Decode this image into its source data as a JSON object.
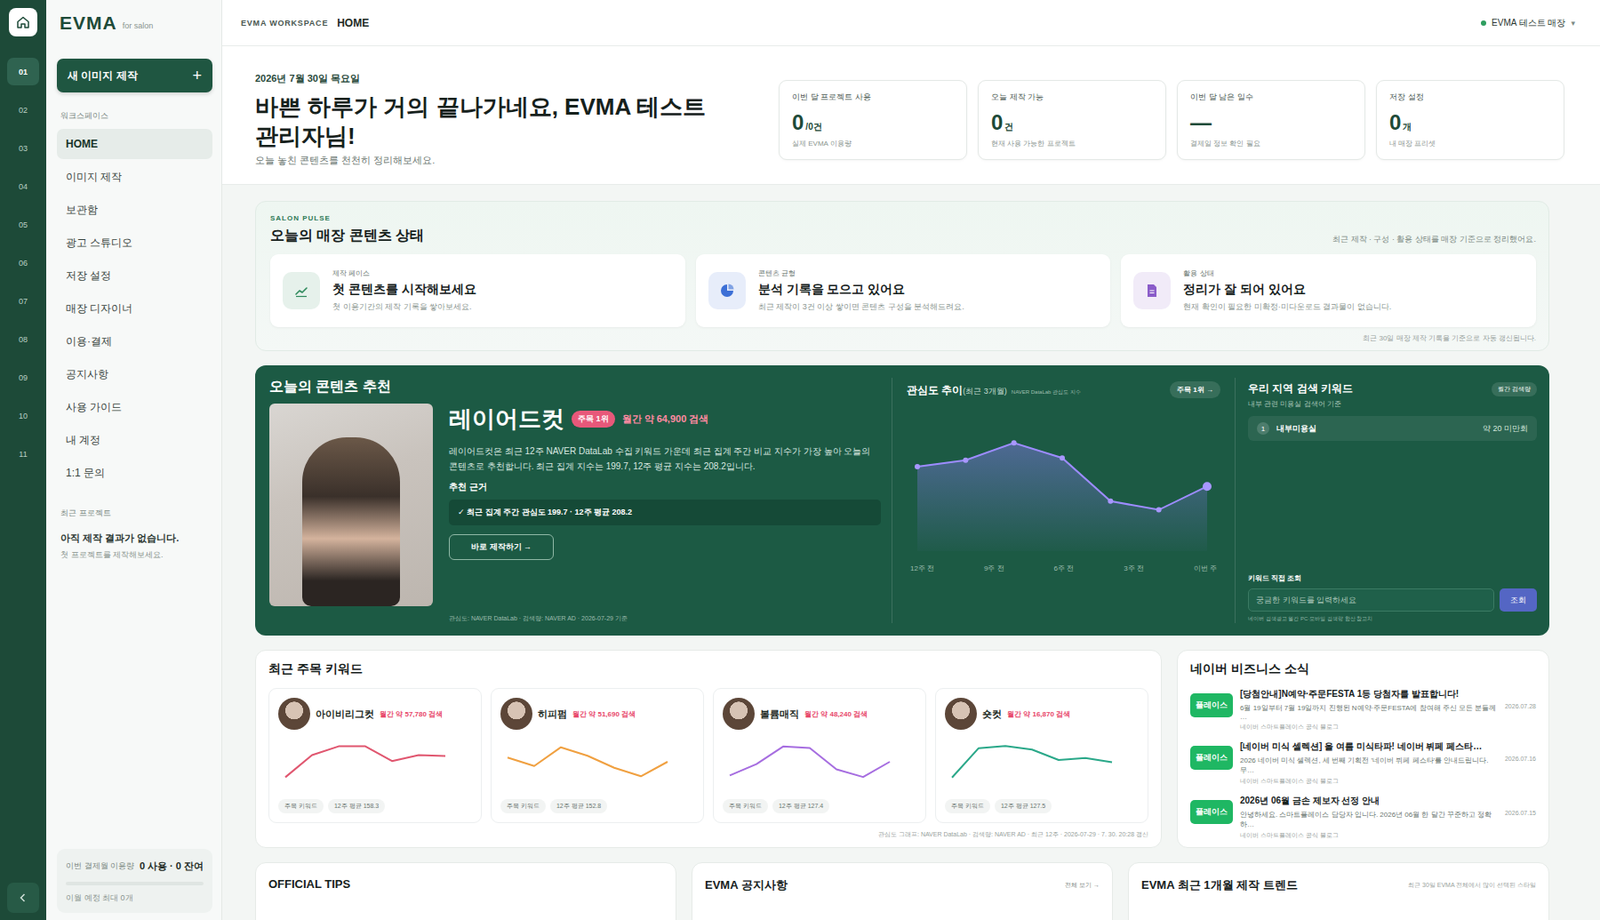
{
  "rail": {
    "items": [
      {
        "label": "01",
        "selected": true
      },
      {
        "label": "02",
        "selected": false
      },
      {
        "label": "03",
        "selected": false
      },
      {
        "label": "04",
        "selected": false
      },
      {
        "label": "05",
        "selected": false
      },
      {
        "label": "06",
        "selected": false
      },
      {
        "label": "07",
        "selected": false
      },
      {
        "label": "08",
        "selected": false
      },
      {
        "label": "09",
        "selected": false
      },
      {
        "label": "10",
        "selected": false
      },
      {
        "label": "11",
        "selected": false
      }
    ]
  },
  "brand": {
    "name": "EVMA",
    "tagline": "for salon"
  },
  "sidebar": {
    "new_button": "새 이미지 제작",
    "new_icon": "+",
    "section": "워크스페이스",
    "items": [
      {
        "label": "HOME",
        "selected": true
      },
      {
        "label": "이미지 제작",
        "selected": false
      },
      {
        "label": "보관함",
        "selected": false
      },
      {
        "label": "광고 스튜디오",
        "selected": false
      },
      {
        "label": "저장 설정",
        "selected": false
      },
      {
        "label": "매장 디자이너",
        "selected": false
      },
      {
        "label": "이용·결제",
        "selected": false
      },
      {
        "label": "공지사항",
        "selected": false
      },
      {
        "label": "사용 가이드",
        "selected": false
      },
      {
        "label": "내 계정",
        "selected": false
      },
      {
        "label": "1:1 문의",
        "selected": false
      }
    ],
    "recent_title": "최근 프로젝트",
    "recent_empty": "아직 제작 결과가 없습니다.",
    "recent_hint": "첫 프로젝트를 제작해보세요.",
    "usage": {
      "label": "이번 결제월 이용량",
      "value": "0 사용 · 0 잔여",
      "level": 0,
      "note": "이월 예정 최대 0개"
    }
  },
  "topbar": {
    "workspace": "EVMA WORKSPACE",
    "page": "HOME",
    "store": "EVMA 테스트 매장",
    "store_caret": "▾"
  },
  "header": {
    "date": "2026년 7월 30일 목요일",
    "title": "바쁜 하루가 거의 끝나가네요, EVMA 테스트 관리자님!",
    "subtitle": "오늘 놓친 콘텐츠를 천천히 정리해보세요.",
    "stats": [
      {
        "label": "이번 달 프로젝트 사용",
        "value": "0",
        "unit": "/0건",
        "note": "실제 EVMA 이용량"
      },
      {
        "label": "오늘 제작 가능",
        "value": "0",
        "unit": "건",
        "note": "현재 사용 가능한 프로젝트"
      },
      {
        "label": "이번 달 남은 일수",
        "value": "—",
        "unit": "",
        "note": "결제일 정보 확인 필요"
      },
      {
        "label": "저장 설정",
        "value": "0",
        "unit": "개",
        "note": "내 매장 프리셋"
      }
    ]
  },
  "pulse": {
    "eyebrow": "SALON PULSE",
    "title": "오늘의 매장 콘텐츠 상태",
    "note": "최근 제작 · 구성 · 활용 상태를 매장 기준으로 정리했어요.",
    "cards": [
      {
        "label": "제작 페이스",
        "title": "첫 콘텐츠를 시작해보세요",
        "desc": "첫 이용기간의 제작 기록을 쌓아보세요.",
        "color": "#2f8a5c"
      },
      {
        "label": "콘텐츠 균형",
        "title": "분석 기록을 모으고 있어요",
        "desc": "최근 제작이 3건 이상 쌓이면 콘텐츠 구성을 분석해드려요.",
        "color": "#3c6fd6"
      },
      {
        "label": "활용 상태",
        "title": "정리가 잘 되어 있어요",
        "desc": "현재 확인이 필요한 미확정·미다운로드 결과물이 없습니다.",
        "color": "#8a5cc9"
      }
    ],
    "footer": "최근 30일 매장 제작 기록을 기준으로 자동 갱신됩니다."
  },
  "recommend": {
    "title": "오늘의 콘텐츠 추천",
    "keyword": "레이어드컷",
    "badge": "주목 1위",
    "searches": "월간 약 64,900 검색",
    "description": "레이어드컷은 최근 12주 NAVER DataLab 수집 키워드 가운데 최근 집계 주간 비교 지수가 가장 높아 오늘의 콘텐츠로 추천합니다. 최근 집계 지수는 199.7, 12주 평균 지수는 208.2입니다.",
    "reason_title": "추천 근거",
    "reason": "✓ 최근 집계 주간 관심도 199.7 · 12주 평균 208.2",
    "cta": "바로 제작하기 →",
    "source": "관심도: NAVER DataLab · 검색량: NAVER AD · 2026-07-29 기준",
    "chart": {
      "title": "관심도 추이",
      "period": "(최근 3개월)",
      "source": "NAVER DataLab 관심도 지수",
      "button": "주목 1위 →",
      "x_labels": [
        "12주 전",
        "9주 전",
        "6주 전",
        "3주 전",
        "이번 주"
      ],
      "values": [
        218,
        224,
        240,
        226,
        186,
        178,
        199.7
      ]
    },
    "local": {
      "title": "우리 지역 검색 키워드",
      "badge": "월간 검색량",
      "subtitle": "내부 관련 미용실 검색어 기준",
      "rows": [
        {
          "rank": "1",
          "keyword": "내부미용실",
          "volume": "약 20 미만회"
        }
      ],
      "lookup_title": "키워드 직접 조회",
      "placeholder": "궁금한 키워드를 입력하세요",
      "button": "조회",
      "note": "네이버 검색광고 월간 PC·모바일 검색량 합산 참고치"
    }
  },
  "keywords": {
    "title": "최근 주목 키워드",
    "items": [
      {
        "name": "아이비리그컷",
        "searches": "월간 약 57,780 검색",
        "tag": "주목 키워드",
        "avg": "12주 평균 158.3",
        "color": "#e0566f",
        "values": [
          120,
          150,
          162,
          162,
          142,
          150,
          149
        ]
      },
      {
        "name": "히피펌",
        "searches": "월간 약 51,690 검색",
        "tag": "주목 키워드",
        "avg": "12주 평균 152.8",
        "color": "#f0a040",
        "values": [
          150,
          140,
          162,
          152,
          138,
          128,
          145
        ]
      },
      {
        "name": "볼륨매직",
        "searches": "월간 약 48,240 검색",
        "tag": "주목 키워드",
        "avg": "12주 평균 127.4",
        "color": "#a66de0",
        "values": [
          110,
          125,
          148,
          146,
          118,
          108,
          128
        ]
      },
      {
        "name": "숏컷",
        "searches": "월간 약 16,870 검색",
        "tag": "주목 키워드",
        "avg": "12주 평균 127.5",
        "color": "#2aa889",
        "values": [
          100,
          142,
          145,
          140,
          125,
          128,
          122
        ]
      }
    ],
    "footer": "관심도 그래프: NAVER DataLab · 검색량: NAVER AD · 최근 12주 · 2026-07-29 · 7. 30. 20:28 갱신"
  },
  "news": {
    "title": "네이버 비즈니스 소식",
    "items": [
      {
        "tag": "플레이스",
        "title": "[당첨안내]N예약·주문FESTA 1등 당첨자를 발표합니다!",
        "desc": "6월 19일부터 7월 19일까지 진행된 N예약·주문FESTA에 참여해 주신 모든 분들께 …",
        "source": "네이버 스마트플레이스 공식 블로그",
        "date": "2026.07.28"
      },
      {
        "tag": "플레이스",
        "title": "[네이버 미식 셀렉션] 올 여름 미식타파! 네이버 뷔페 페스타…",
        "desc": "2026 네이버 미식 셀렉션, 세 번째 기획전 '네이버 뷔페 페스타'를 안내드립니다. 무…",
        "source": "네이버 스마트플레이스 공식 블로그",
        "date": "2026.07.16"
      },
      {
        "tag": "플레이스",
        "title": "2026년 06월 금손 제보자 선정 안내",
        "desc": "안녕하세요. 스마트플레이스 담당자 입니다. 2026년 06월 한 달간 꾸준하고 정확하…",
        "source": "네이버 스마트플레이스 공식 블로그",
        "date": "2026.07.15"
      }
    ]
  },
  "bottom": {
    "tips_title": "OFFICIAL TIPS",
    "notice_title": "EVMA 공지사항",
    "notice_link": "전체 보기 →",
    "trend_title": "EVMA 최근 1개월 제작 트렌드",
    "trend_note": "최근 30일 EVMA 전체에서 많이 선택된 스타일"
  }
}
